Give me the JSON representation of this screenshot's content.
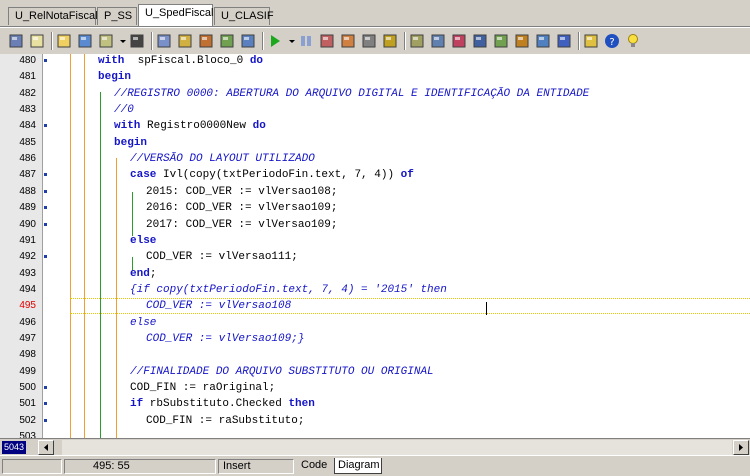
{
  "tabs": [
    {
      "label": "U_RelNotaFiscal",
      "active": false
    },
    {
      "label": "P_SS",
      "active": false
    },
    {
      "label": "U_SpedFiscal",
      "active": true
    },
    {
      "label": "U_CLASIF",
      "active": false
    }
  ],
  "toolbar": {
    "icons": [
      "new-form-icon",
      "new-unit-icon",
      "open-icon",
      "save-icon",
      "view-units-icon",
      "dropdown-icon",
      "stop-icon",
      "save-all-icon",
      "build-icon",
      "compile-icon",
      "check-icon",
      "toggle-form-unit-icon",
      "run-icon",
      "run-dropdown-icon",
      "pause-icon",
      "trace-into-icon",
      "step-over-icon",
      "run-to-cursor-icon",
      "component-icon",
      "project-icon",
      "options-icon",
      "add-file-icon",
      "remove-file-icon",
      "database-icon",
      "object-inspector-icon",
      "form-list-icon",
      "unit-list-icon",
      "palette-icon",
      "help-icon",
      "tip-icon"
    ]
  },
  "editor": {
    "lines": [
      {
        "num": "480",
        "dot": true,
        "html_key": "l480"
      },
      {
        "num": "481",
        "dot": false,
        "html_key": "l481"
      },
      {
        "num": "482",
        "dot": false,
        "html_key": "l482"
      },
      {
        "num": "483",
        "dot": false,
        "html_key": "l483"
      },
      {
        "num": "484",
        "dot": true,
        "html_key": "l484"
      },
      {
        "num": "485",
        "dot": false,
        "html_key": "l485"
      },
      {
        "num": "486",
        "dot": false,
        "html_key": "l486"
      },
      {
        "num": "487",
        "dot": true,
        "html_key": "l487"
      },
      {
        "num": "488",
        "dot": true,
        "html_key": "l488"
      },
      {
        "num": "489",
        "dot": true,
        "html_key": "l489"
      },
      {
        "num": "490",
        "dot": true,
        "html_key": "l490"
      },
      {
        "num": "491",
        "dot": false,
        "html_key": "l491"
      },
      {
        "num": "492",
        "dot": true,
        "html_key": "l492"
      },
      {
        "num": "493",
        "dot": false,
        "html_key": "l493"
      },
      {
        "num": "494",
        "dot": false,
        "html_key": "l494"
      },
      {
        "num": "495",
        "dot": false,
        "html_key": "l495"
      },
      {
        "num": "496",
        "dot": false,
        "html_key": "l496"
      },
      {
        "num": "497",
        "dot": false,
        "html_key": "l497"
      },
      {
        "num": "498",
        "dot": false,
        "html_key": "l498"
      },
      {
        "num": "499",
        "dot": false,
        "html_key": "l499"
      },
      {
        "num": "500",
        "dot": true,
        "html_key": "l500"
      },
      {
        "num": "501",
        "dot": true,
        "html_key": "l501"
      },
      {
        "num": "502",
        "dot": true,
        "html_key": "l502"
      },
      {
        "num": "503",
        "dot": false,
        "html_key": "l503"
      }
    ],
    "code": {
      "l480": [
        [
          "kw",
          "with"
        ],
        [
          "",
          "  spFiscal.Bloco_0 "
        ],
        [
          "kw",
          "do"
        ]
      ],
      "l481": [
        [
          "kw",
          "begin"
        ]
      ],
      "l482": [
        [
          "cm",
          "//REGISTRO 0000: ABERTURA DO ARQUIVO DIGITAL E IDENTIFICAÇÃO DA ENTIDADE"
        ]
      ],
      "l483": [
        [
          "cm",
          "//0"
        ]
      ],
      "l484": [
        [
          "kw",
          "with"
        ],
        [
          "",
          " Registro0000New "
        ],
        [
          "kw",
          "do"
        ]
      ],
      "l485": [
        [
          "kw",
          "begin"
        ]
      ],
      "l486": [
        [
          "cm",
          "//VERSÃO DO LAYOUT UTILIZADO"
        ]
      ],
      "l487": [
        [
          "kw",
          "case"
        ],
        [
          "",
          " Ivl(copy(txtPeriodoFin.text, 7, 4)) "
        ],
        [
          "kw",
          "of"
        ]
      ],
      "l488": [
        [
          "",
          "2015: COD_VER := vlVersao108;"
        ]
      ],
      "l489": [
        [
          "",
          "2016: COD_VER := vlVersao109;"
        ]
      ],
      "l490": [
        [
          "",
          "2017: COD_VER := vlVersao109;"
        ]
      ],
      "l491": [
        [
          "kw",
          "else"
        ]
      ],
      "l492": [
        [
          "",
          "COD_VER := vlVersao111;"
        ]
      ],
      "l493": [
        [
          "kw",
          "end"
        ],
        [
          "",
          ";"
        ]
      ],
      "l494": [
        [
          "cm",
          "{if copy(txtPeriodoFin.text, 7, 4) = '2015' then"
        ]
      ],
      "l495": [
        [
          "cm",
          "COD_VER := vlVersao108"
        ]
      ],
      "l496": [
        [
          "cm",
          "else"
        ]
      ],
      "l497": [
        [
          "cm",
          "COD_VER := vlVersao109;}"
        ]
      ],
      "l498": [
        [
          "",
          ""
        ]
      ],
      "l499": [
        [
          "cm",
          "//FINALIDADE DO ARQUIVO SUBSTITUTO OU ORIGINAL"
        ]
      ],
      "l500": [
        [
          "",
          "COD_FIN := raOriginal;"
        ]
      ],
      "l501": [
        [
          "kw",
          "if"
        ],
        [
          "",
          " rbSubstituto.Checked "
        ],
        [
          "kw",
          "then"
        ]
      ],
      "l502": [
        [
          "",
          "COD_FIN := raSubstituto;"
        ]
      ],
      "l503": [
        [
          "",
          ""
        ]
      ]
    },
    "indent": {
      "l480": 0,
      "l481": 0,
      "l482": 1,
      "l483": 1,
      "l484": 1,
      "l485": 1,
      "l486": 2,
      "l487": 2,
      "l488": 3,
      "l489": 3,
      "l490": 3,
      "l491": 2,
      "l492": 3,
      "l493": 2,
      "l494": 2,
      "l495": 3,
      "l496": 2,
      "l497": 3,
      "l498": 2,
      "l499": 2,
      "l500": 2,
      "l501": 2,
      "l502": 3,
      "l503": 2
    },
    "current_line": "495"
  },
  "scroll": {
    "position_badge": "5043"
  },
  "status": {
    "cursor_pos": "495: 55",
    "mode": "Insert",
    "views": [
      {
        "label": "Code",
        "active": false
      },
      {
        "label": "Diagram",
        "active": true
      }
    ]
  },
  "colors": {
    "keyword": "#1515c8",
    "comment": "#1515c8",
    "current_line_number": "#e00000",
    "gutter_dot": "#1f3fa8"
  }
}
